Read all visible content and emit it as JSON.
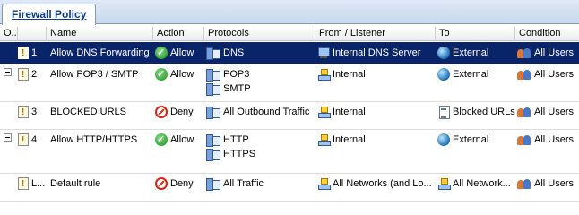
{
  "tab": {
    "label": "Firewall Policy"
  },
  "columns": [
    "O...",
    "Name",
    "Action",
    "Protocols",
    "From / Listener",
    "To",
    "Condition"
  ],
  "rules": [
    {
      "order": "1",
      "name": "Allow DNS Forwarding",
      "action": "Allow",
      "action_icon": "allow-icon",
      "protocols": [
        "DNS"
      ],
      "from": "Internal DNS Server",
      "from_icon": "server-icon",
      "to": "External",
      "to_icon": "globe-icon",
      "condition": "All Users",
      "selected": true,
      "expandable": false
    },
    {
      "order": "2",
      "name": "Allow POP3 / SMTP",
      "action": "Allow",
      "action_icon": "allow-icon",
      "protocols": [
        "POP3",
        "SMTP"
      ],
      "from": "Internal",
      "from_icon": "network-icon",
      "to": "External",
      "to_icon": "globe-icon",
      "condition": "All Users",
      "selected": false,
      "expandable": true
    },
    {
      "order": "3",
      "name": "BLOCKED  URLS",
      "action": "Deny",
      "action_icon": "deny-icon",
      "protocols": [
        "All Outbound Traffic"
      ],
      "from": "Internal",
      "from_icon": "network-icon",
      "to": "Blocked URLs",
      "to_icon": "list-icon",
      "condition": "All Users",
      "selected": false,
      "expandable": false
    },
    {
      "order": "4",
      "name": "Allow HTTP/HTTPS",
      "action": "Allow",
      "action_icon": "allow-icon",
      "protocols": [
        "HTTP",
        "HTTPS"
      ],
      "from": "Internal",
      "from_icon": "network-icon",
      "to": "External",
      "to_icon": "globe-icon",
      "condition": "All Users",
      "selected": false,
      "expandable": true
    },
    {
      "order": "L...",
      "name": "Default rule",
      "action": "Deny",
      "action_icon": "deny-icon",
      "protocols": [
        "All Traffic"
      ],
      "from": "All Networks (and Lo...",
      "from_icon": "network-icon",
      "to": "All Network...",
      "to_icon": "network-icon",
      "condition": "All Users",
      "selected": false,
      "expandable": false
    }
  ]
}
